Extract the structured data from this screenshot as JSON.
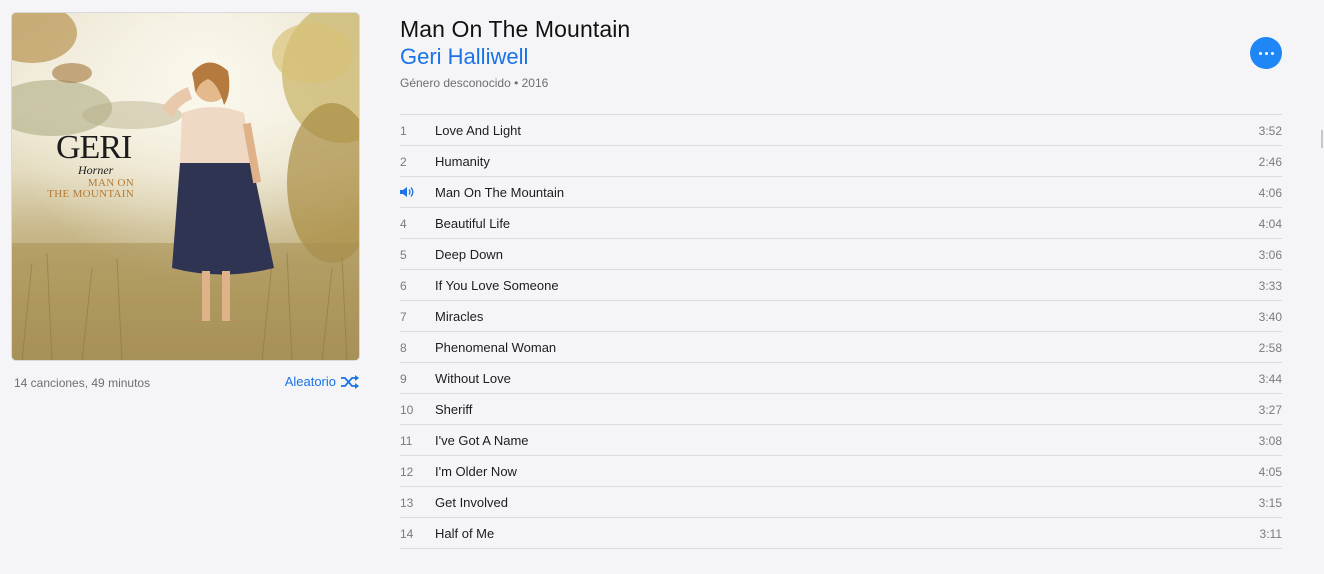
{
  "album": {
    "title": "Man On The Mountain",
    "artist": "Geri Halliwell",
    "genre_year": "Género desconocido • 2016",
    "summary": "14 canciones, 49 minutos",
    "shuffle_label": "Aleatorio",
    "artwork": {
      "logo_big": "GERI",
      "logo_script": "Horner",
      "logo_sub_1": "MAN ON",
      "logo_sub_2": "THE MOUNTAIN"
    }
  },
  "now_playing_index": 2,
  "colors": {
    "accent": "#1a73e8",
    "more_button": "#1f87f5",
    "background": "#f5f5f7"
  },
  "icons": {
    "more": "more-options-icon",
    "shuffle": "shuffle-icon",
    "playing": "speaker-icon"
  },
  "tracks": [
    {
      "num": "1",
      "name": "Love And Light",
      "duration": "3:52"
    },
    {
      "num": "2",
      "name": "Humanity",
      "duration": "2:46"
    },
    {
      "num": "3",
      "name": "Man On The Mountain",
      "duration": "4:06"
    },
    {
      "num": "4",
      "name": "Beautiful Life",
      "duration": "4:04"
    },
    {
      "num": "5",
      "name": "Deep Down",
      "duration": "3:06"
    },
    {
      "num": "6",
      "name": "If You Love Someone",
      "duration": "3:33"
    },
    {
      "num": "7",
      "name": "Miracles",
      "duration": "3:40"
    },
    {
      "num": "8",
      "name": "Phenomenal Woman",
      "duration": "2:58"
    },
    {
      "num": "9",
      "name": "Without Love",
      "duration": "3:44"
    },
    {
      "num": "10",
      "name": "Sheriff",
      "duration": "3:27"
    },
    {
      "num": "11",
      "name": "I've Got A Name",
      "duration": "3:08"
    },
    {
      "num": "12",
      "name": "I'm Older Now",
      "duration": "4:05"
    },
    {
      "num": "13",
      "name": "Get Involved",
      "duration": "3:15"
    },
    {
      "num": "14",
      "name": "Half of Me",
      "duration": "3:11"
    }
  ]
}
